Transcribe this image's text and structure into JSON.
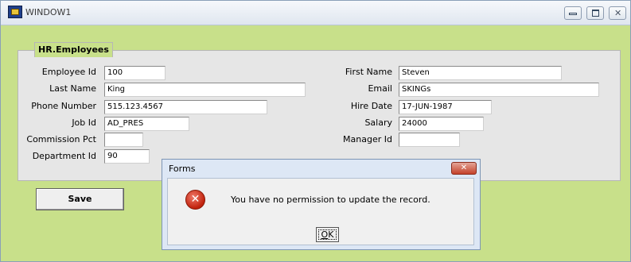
{
  "window": {
    "title": "WINDOW1",
    "icon": "forms-app-icon",
    "controls": {
      "minimize": "minimize-icon",
      "maximize": "maximize-icon",
      "close": "✕"
    }
  },
  "form": {
    "group_title": "HR.Employees",
    "fields": {
      "employee_id": {
        "label": "Employee Id",
        "value": "100"
      },
      "last_name": {
        "label": "Last Name",
        "value": "King"
      },
      "phone_number": {
        "label": "Phone Number",
        "value": "515.123.4567"
      },
      "job_id": {
        "label": "Job Id",
        "value": "AD_PRES"
      },
      "commission_pct": {
        "label": "Commission Pct",
        "value": ""
      },
      "department_id": {
        "label": "Department Id",
        "value": "90"
      },
      "first_name": {
        "label": "First Name",
        "value": "Steven"
      },
      "email": {
        "label": "Email",
        "value": "SKINGs"
      },
      "hire_date": {
        "label": "Hire Date",
        "value": "17-JUN-1987"
      },
      "salary": {
        "label": "Salary",
        "value": "24000"
      },
      "manager_id": {
        "label": "Manager Id",
        "value": ""
      }
    },
    "save_label": "Save"
  },
  "dialog": {
    "title": "Forms",
    "close_glyph": "✕",
    "icon": "error-icon",
    "icon_glyph": "✕",
    "message": "You have no permission to update the record.",
    "ok_label": "OK",
    "ok_accel": "O",
    "ok_rest": "K"
  },
  "colors": {
    "window_bg": "#c8e08a",
    "panel_bg": "#e6e6e6",
    "dialog_frame": "#dde7f5",
    "error_red": "#c0210c"
  }
}
